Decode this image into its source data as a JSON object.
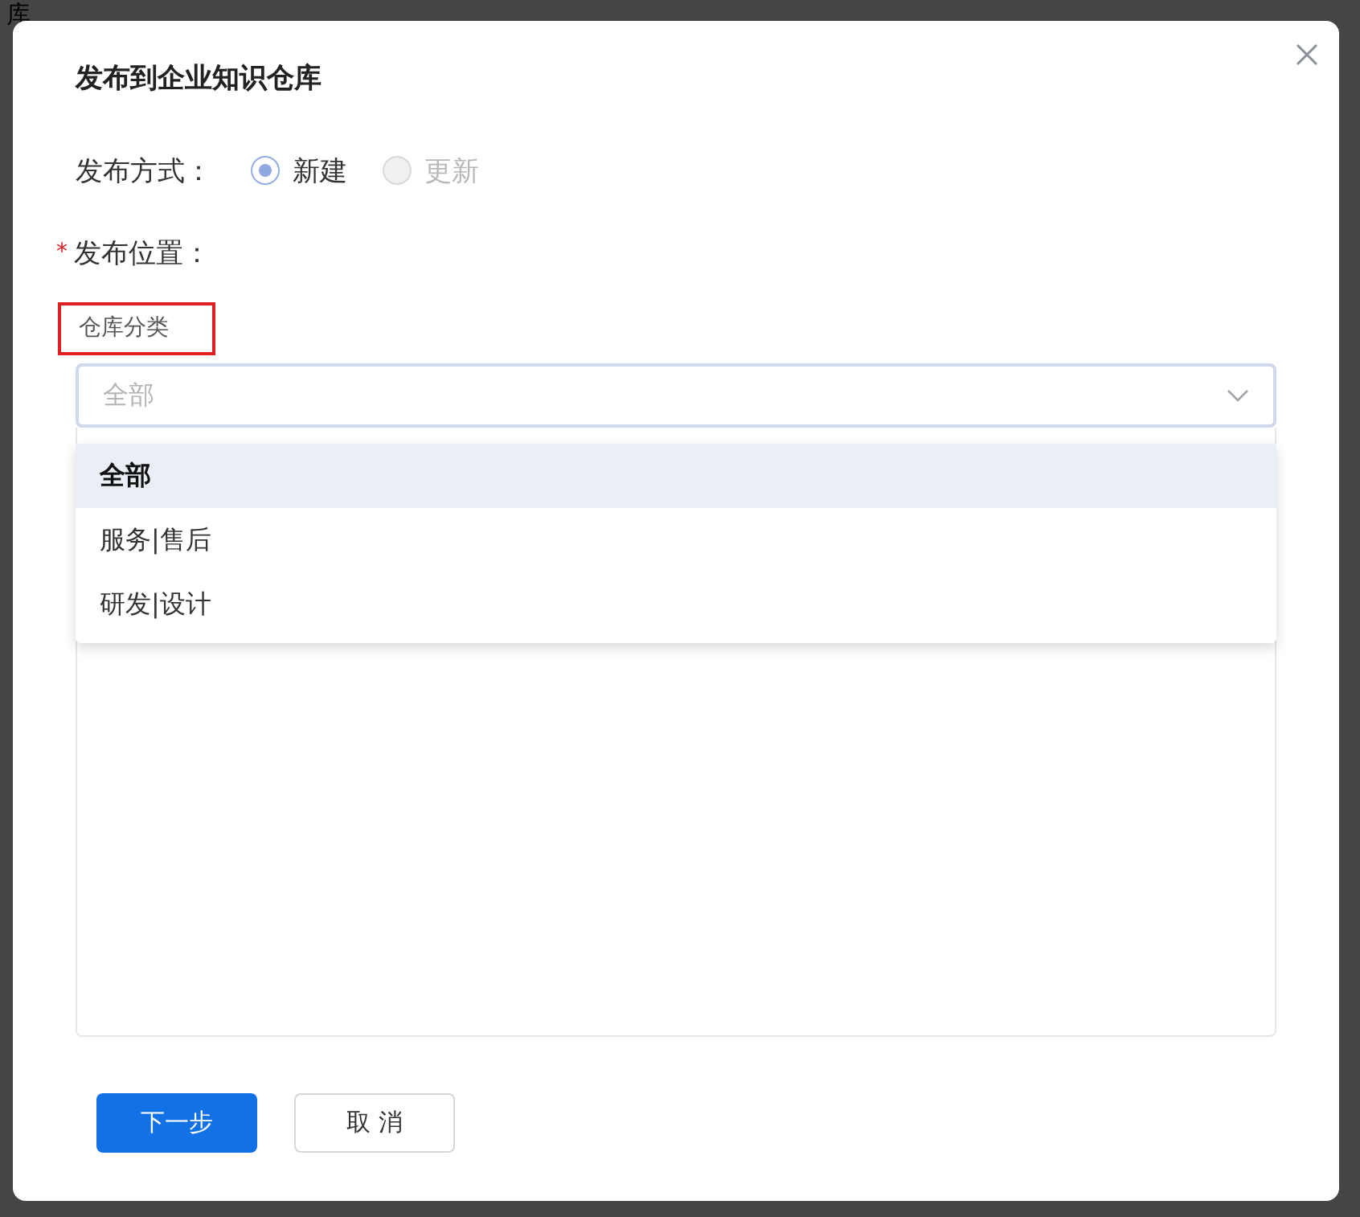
{
  "background": {
    "text": "库"
  },
  "dialog": {
    "title": "发布到企业知识仓库"
  },
  "publish_mode": {
    "label": "发布方式：",
    "options": [
      {
        "label": "新建",
        "selected": true,
        "disabled": false
      },
      {
        "label": "更新",
        "selected": false,
        "disabled": true
      }
    ]
  },
  "location": {
    "required_mark": "*",
    "label": "发布位置："
  },
  "category": {
    "label": "仓库分类",
    "highlighted": true,
    "placeholder": "全部",
    "expanded": true,
    "options": [
      {
        "label": "全部",
        "selected": true
      },
      {
        "label": "服务|售后",
        "selected": false
      },
      {
        "label": "研发|设计",
        "selected": false
      }
    ]
  },
  "buttons": [
    {
      "label": "下一步",
      "kind": "primary"
    },
    {
      "label": "取 消",
      "kind": "secondary"
    }
  ]
}
